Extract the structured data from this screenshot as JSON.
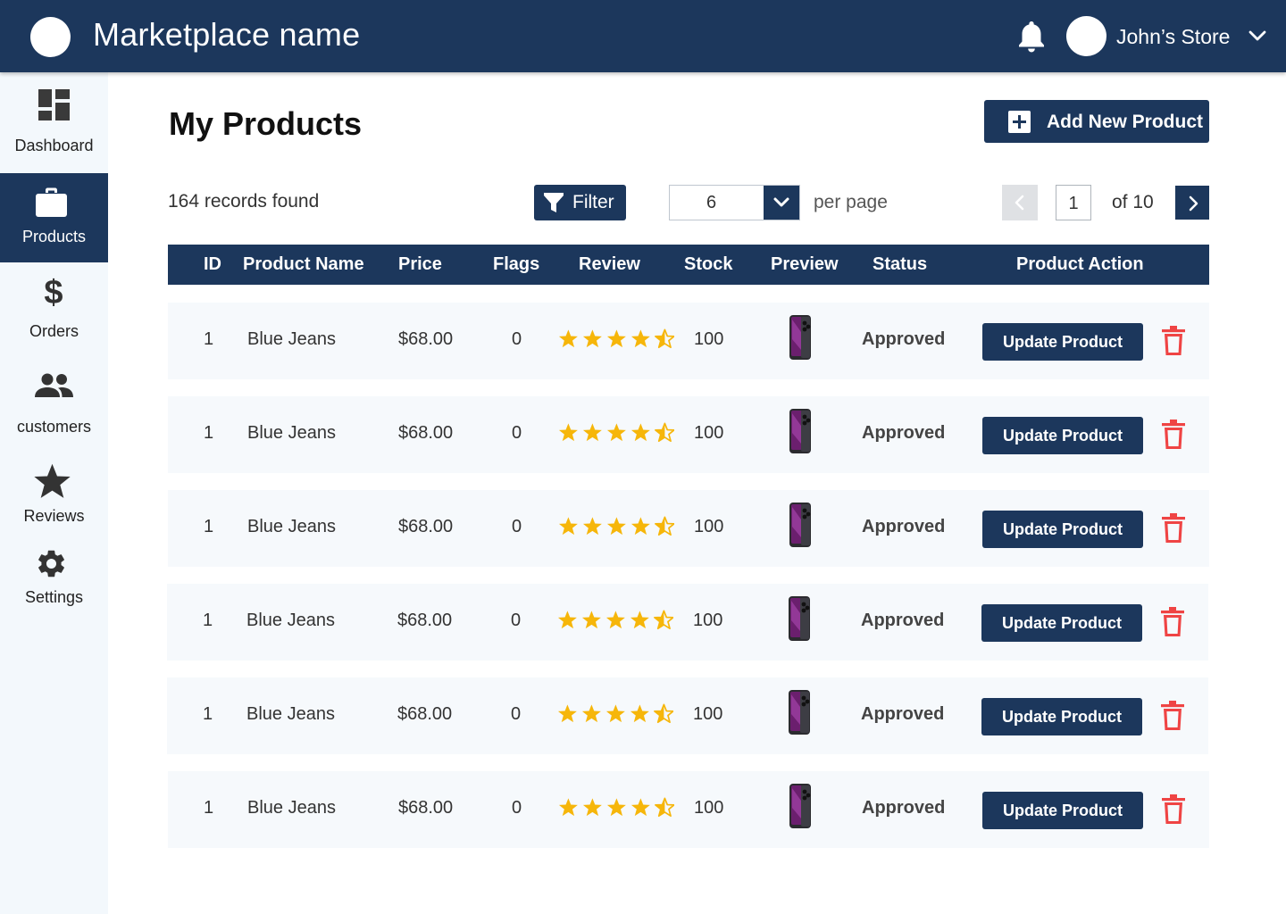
{
  "header": {
    "brand": "Marketplace name",
    "store_name": "John’s Store"
  },
  "sidebar": {
    "items": [
      {
        "label": "Dashboard",
        "icon": "dashboard-icon"
      },
      {
        "label": "Products",
        "icon": "briefcase-icon",
        "active": true
      },
      {
        "label": "Orders",
        "icon": "dollar-icon"
      },
      {
        "label": "customers",
        "icon": "people-icon"
      },
      {
        "label": "Reviews",
        "icon": "star-icon"
      },
      {
        "label": "Settings",
        "icon": "gear-icon"
      }
    ]
  },
  "main": {
    "title": "My Products",
    "add_button": "Add New Product",
    "records": "164 records found",
    "filter": "Filter",
    "per_page_value": "6",
    "per_page_label": "per page",
    "page": "1",
    "page_of": "of 10"
  },
  "table": {
    "headers": [
      "ID",
      "Product Name",
      "Price",
      "Flags",
      "Review",
      "Stock",
      "Preview",
      "Status",
      "Product Action"
    ],
    "rows": [
      {
        "id": "1",
        "name": "Blue Jeans",
        "price": "$68.00",
        "flags": "0",
        "rating": 4.5,
        "stock": "100",
        "status": "Approved",
        "action": "Update Product"
      },
      {
        "id": "1",
        "name": "Blue Jeans",
        "price": "$68.00",
        "flags": "0",
        "rating": 4.5,
        "stock": "100",
        "status": "Approved",
        "action": "Update Product"
      },
      {
        "id": "1",
        "name": "Blue Jeans",
        "price": "$68.00",
        "flags": "0",
        "rating": 4.5,
        "stock": "100",
        "status": "Approved",
        "action": "Update Product"
      },
      {
        "id": "1",
        "name": "Blue Jeans",
        "price": "$68.00",
        "flags": "0",
        "rating": 4.5,
        "stock": "100",
        "status": "Approved",
        "action": "Update Product"
      },
      {
        "id": "1",
        "name": "Blue Jeans",
        "price": "$68.00",
        "flags": "0",
        "rating": 4.5,
        "stock": "100",
        "status": "Approved",
        "action": "Update Product"
      },
      {
        "id": "1",
        "name": "Blue Jeans",
        "price": "$68.00",
        "flags": "0",
        "rating": 4.5,
        "stock": "100",
        "status": "Approved",
        "action": "Update Product"
      }
    ]
  },
  "colors": {
    "primary": "#1c375c",
    "star": "#f6b60a",
    "danger": "#ef4444",
    "row_bg": "#f6f9fc",
    "sidebar_bg": "#f3f8fc"
  }
}
